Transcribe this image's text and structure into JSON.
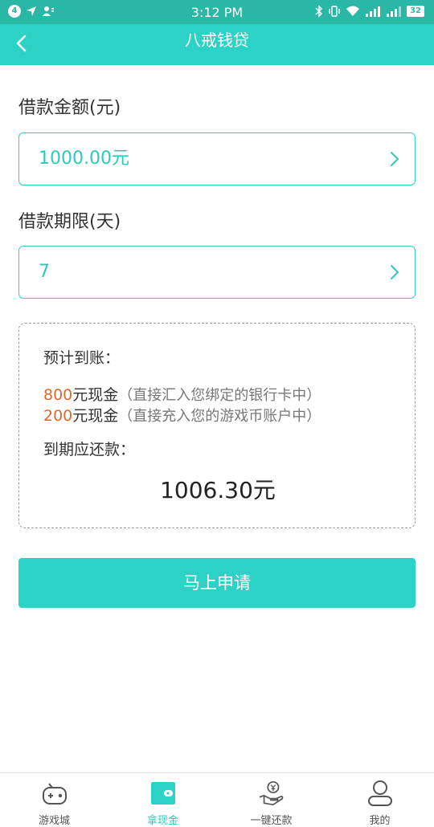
{
  "status_bar": {
    "notification_count": "4",
    "time": "3:12 PM",
    "battery": "32"
  },
  "header": {
    "title": "八戒钱贷",
    "back_icon": "chevron-left-icon"
  },
  "form": {
    "amount_label": "借款金额(元)",
    "amount_value": "1000.00元",
    "term_label": "借款期限(天)",
    "term_value": "7"
  },
  "summary": {
    "title": "预计到账：",
    "lines": [
      {
        "amount": "800",
        "text": "元现金",
        "note": "（直接汇入您绑定的银行卡中）"
      },
      {
        "amount": "200",
        "text": "元现金",
        "note": "（直接充入您的游戏币账户中）"
      }
    ],
    "due_label": "到期应还款：",
    "due_total": "1006.30元"
  },
  "apply_button": "马上申请",
  "tabbar": {
    "items": [
      {
        "label": "游戏城",
        "icon": "gamepad-icon",
        "active": false
      },
      {
        "label": "拿现金",
        "icon": "wallet-icon",
        "active": true
      },
      {
        "label": "一键还款",
        "icon": "hand-coin-icon",
        "active": false
      },
      {
        "label": "我的",
        "icon": "user-icon",
        "active": false
      }
    ]
  },
  "colors": {
    "accent": "#2dd2c6",
    "status_bar": "#2bb7a6",
    "highlight": "#e06a2c"
  }
}
